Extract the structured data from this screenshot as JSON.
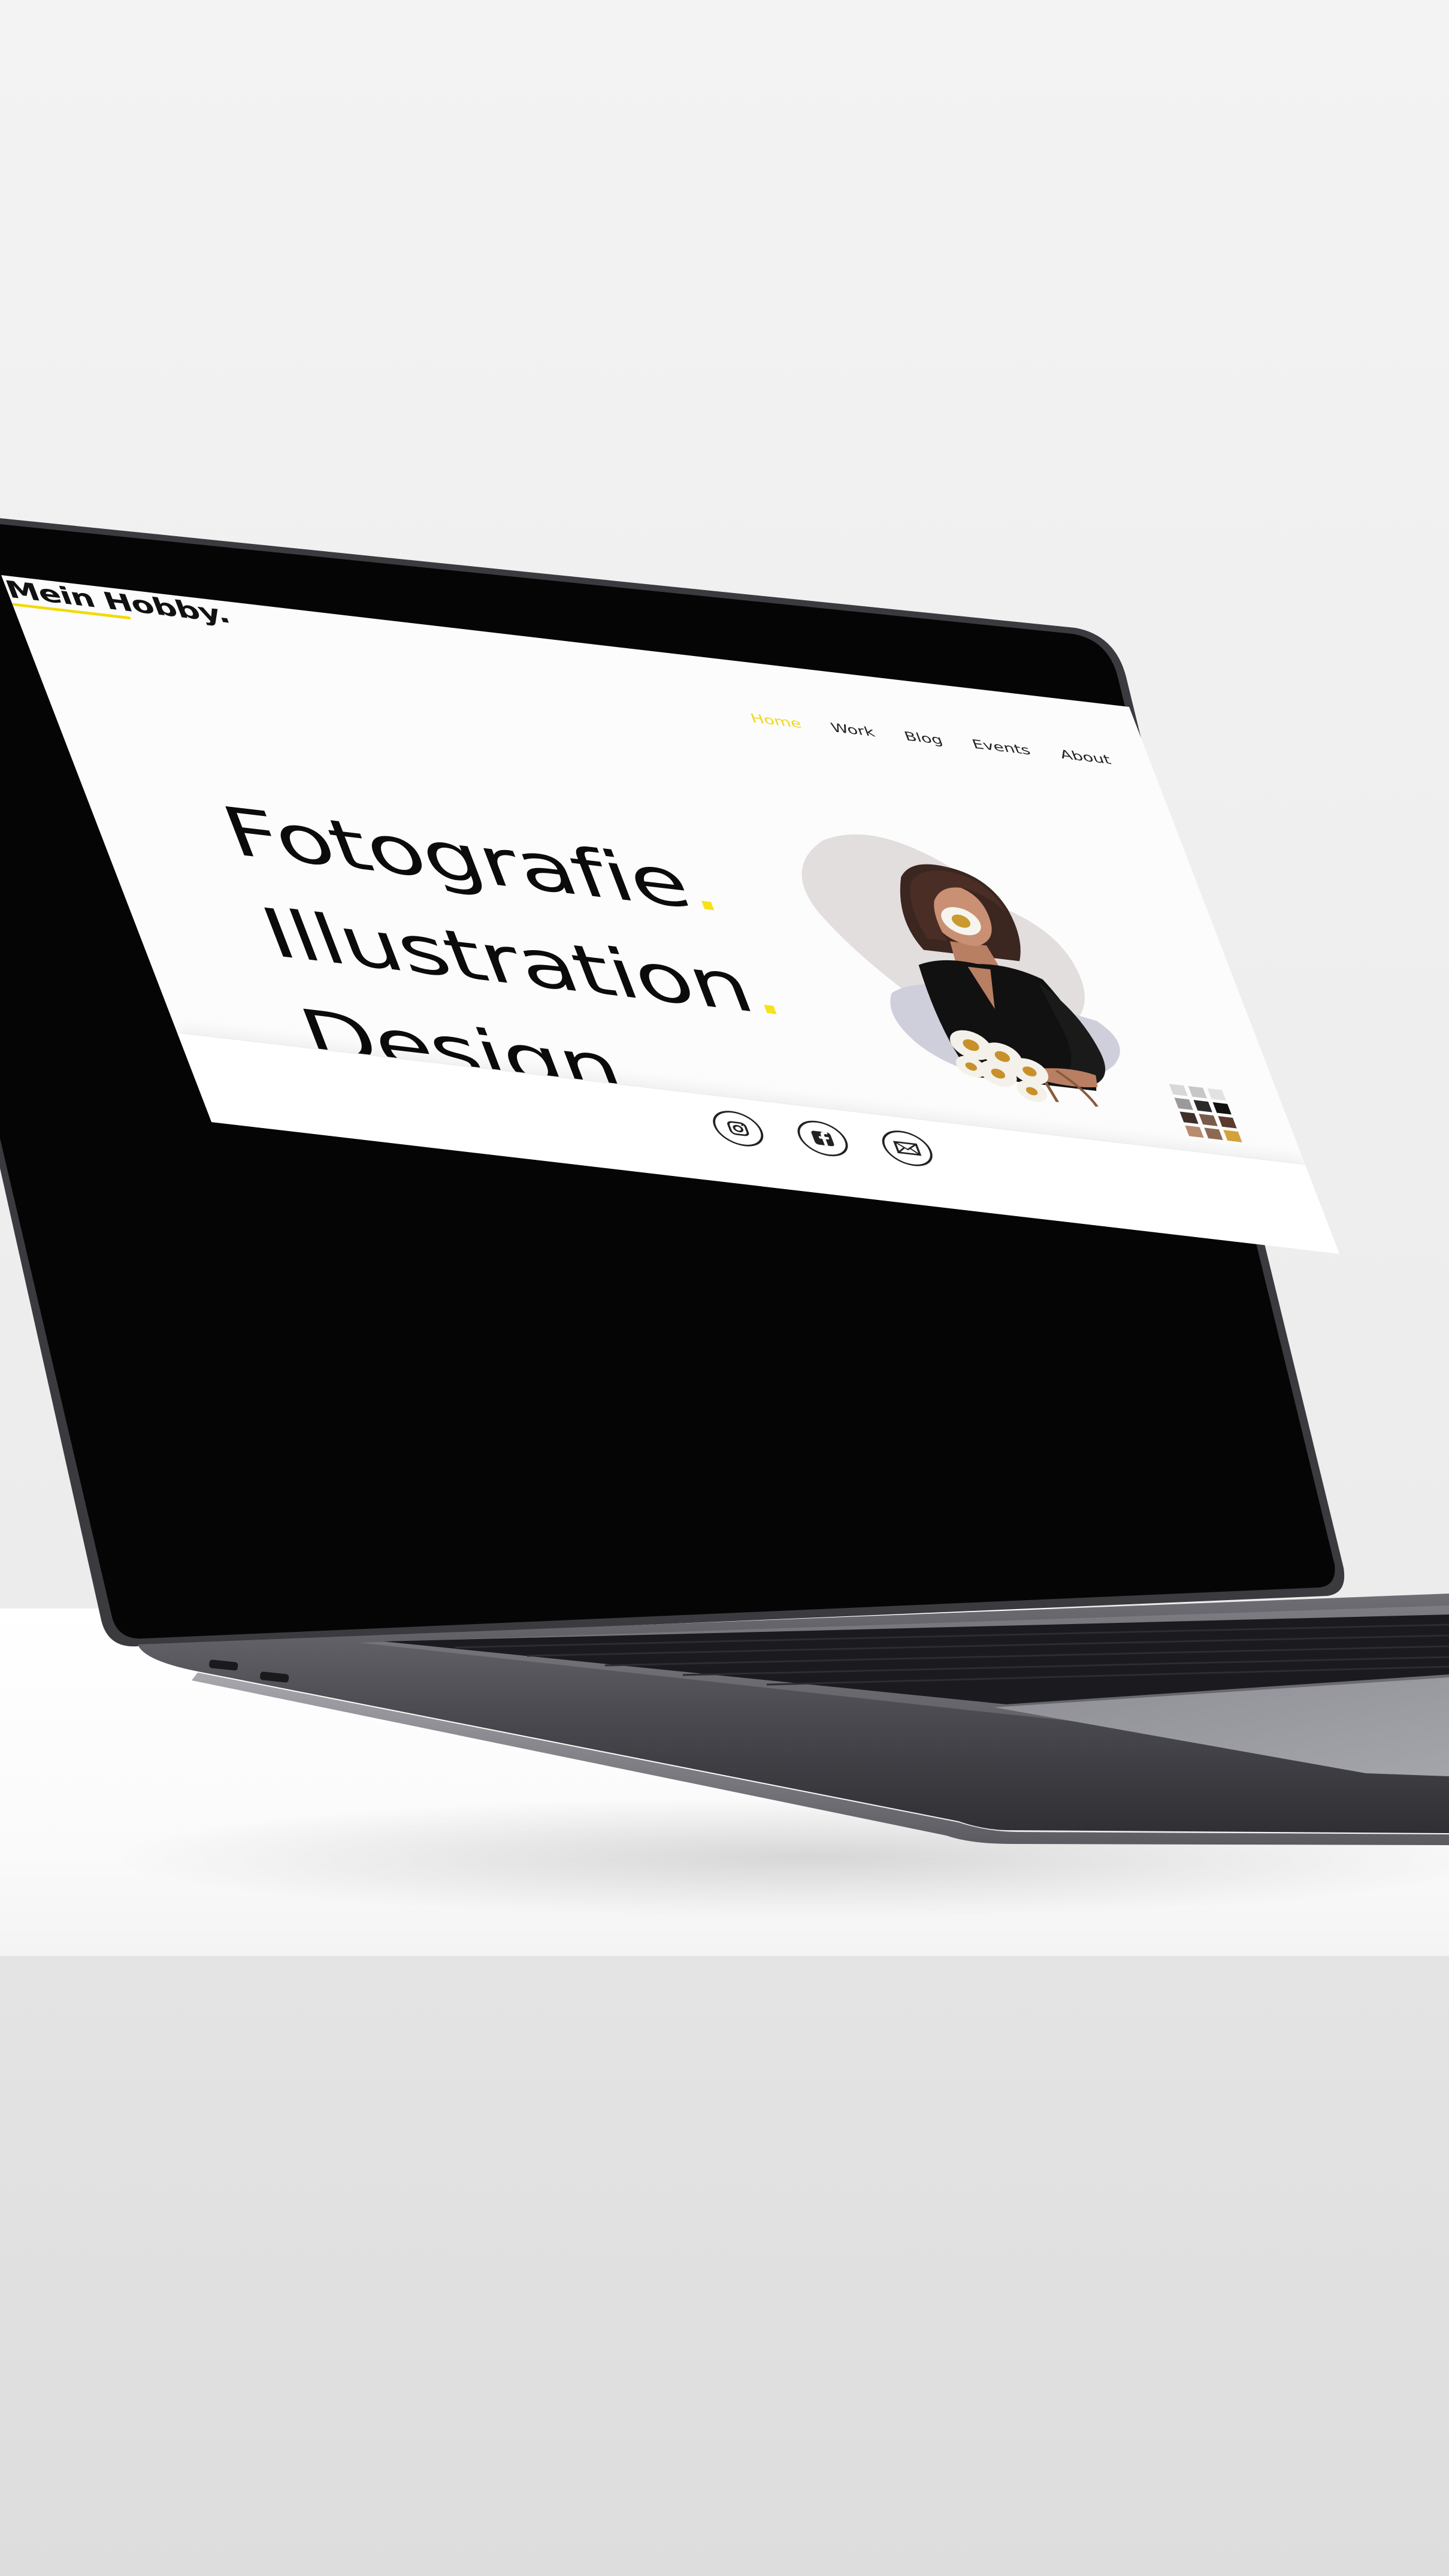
{
  "site": {
    "logo": "Mein Hobby.",
    "accent_color": "#f2d51c"
  },
  "nav": {
    "items": [
      {
        "label": "Home",
        "active": true
      },
      {
        "label": "Work",
        "active": false
      },
      {
        "label": "Blog",
        "active": false
      },
      {
        "label": "Events",
        "active": false
      },
      {
        "label": "About",
        "active": false
      }
    ]
  },
  "hero": {
    "lines": [
      {
        "text": "Fotografie",
        "dot": "."
      },
      {
        "text": "Illustration",
        "dot": "."
      },
      {
        "text": "Design",
        "dot": "."
      }
    ]
  },
  "illustration": {
    "icon": "woman-with-daisies-illustration",
    "palette": [
      "#d8d8d8",
      "#c7c7c7",
      "#e2e2e2",
      "#9a9a9a",
      "#2a2a2a",
      "#111111",
      "#3e2f2a",
      "#7a5a4a",
      "#5a3b2e",
      "#b98a6e",
      "#8c6a52",
      "#d4a23a"
    ]
  },
  "footer": {
    "social": [
      {
        "name": "instagram-icon"
      },
      {
        "name": "facebook-icon"
      },
      {
        "name": "mail-icon"
      }
    ]
  }
}
